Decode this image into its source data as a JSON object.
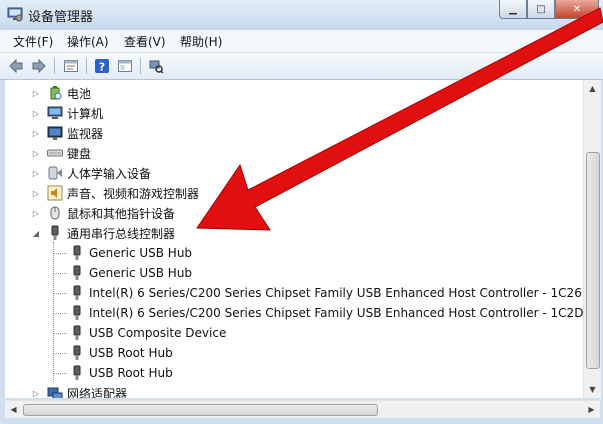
{
  "window": {
    "title": "设备管理器"
  },
  "menu": [
    {
      "label": "文件(F)"
    },
    {
      "label": "操作(A)"
    },
    {
      "label": "查看(V)"
    },
    {
      "label": "帮助(H)"
    }
  ],
  "toolbar": {
    "buttons": [
      "back-icon",
      "forward-icon",
      "properties-icon",
      "help-icon",
      "details-icon",
      "scan-hardware-icon"
    ]
  },
  "tree": {
    "top_items": [
      {
        "label": "电池",
        "icon": "battery-icon",
        "expanded": false
      },
      {
        "label": "计算机",
        "icon": "computer-icon",
        "expanded": false
      },
      {
        "label": "监视器",
        "icon": "monitor-icon",
        "expanded": false
      },
      {
        "label": "键盘",
        "icon": "keyboard-icon",
        "expanded": false
      },
      {
        "label": "人体学输入设备",
        "icon": "hid-icon",
        "expanded": false
      },
      {
        "label": "声音、视频和游戏控制器",
        "icon": "sound-icon",
        "expanded": false
      },
      {
        "label": "鼠标和其他指针设备",
        "icon": "mouse-icon",
        "expanded": false
      },
      {
        "label": "通用串行总线控制器",
        "icon": "usb-icon",
        "expanded": true
      }
    ],
    "usb_children": [
      {
        "label": "Generic USB Hub"
      },
      {
        "label": "Generic USB Hub"
      },
      {
        "label": "Intel(R) 6 Series/C200 Series Chipset Family USB Enhanced Host Controller - 1C26"
      },
      {
        "label": "Intel(R) 6 Series/C200 Series Chipset Family USB Enhanced Host Controller - 1C2D"
      },
      {
        "label": "USB Composite Device"
      },
      {
        "label": "USB Root Hub"
      },
      {
        "label": "USB Root Hub"
      }
    ],
    "after_items": [
      {
        "label": "网络适配器",
        "icon": "network-adapter-icon",
        "expanded": false
      }
    ]
  },
  "colors": {
    "annotation_arrow": "#e01010"
  }
}
